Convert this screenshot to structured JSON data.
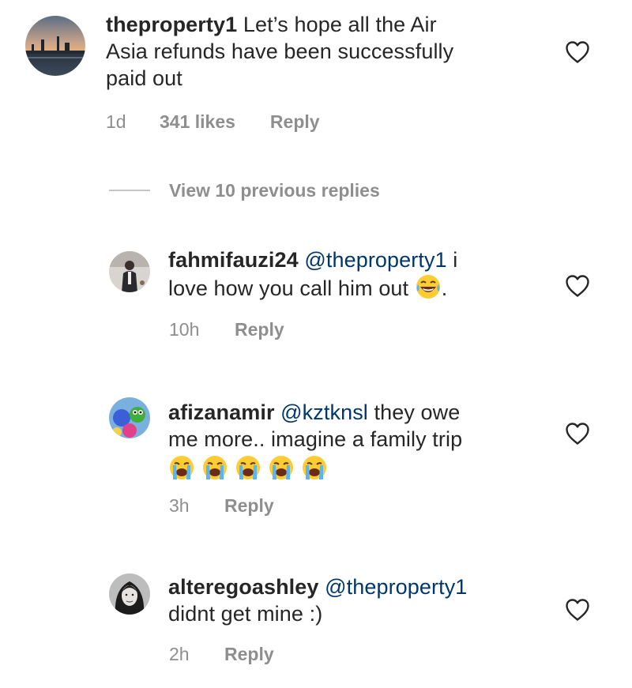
{
  "comments": [
    {
      "username": "theproperty1",
      "text_line1": " Let’s hope all the Air",
      "text_line2": "Asia refunds have been successfully",
      "text_line3": "paid out",
      "time": "1d",
      "likes": "341 likes",
      "reply": "Reply"
    },
    {
      "username": "fahmifauzi24",
      "mention": "@theproperty1",
      "text_line1_tail": " i",
      "text_line2": "love how you call him out ",
      "text_line2_tail": ".",
      "time": "10h",
      "reply": "Reply"
    },
    {
      "username": "afizanamir",
      "mention": "@kztknsl",
      "text_line1_tail": " they owe",
      "text_line2": "me more.. imagine a family trip",
      "time": "3h",
      "reply": "Reply"
    },
    {
      "username": "alteregoashley",
      "mention": "@theproperty1",
      "text_line2": "didnt get mine :)",
      "time": "2h",
      "reply": "Reply"
    }
  ],
  "view_replies": "View 10 previous replies",
  "icons": {
    "like": "heart-outline-icon",
    "laugh": "face-with-tears-of-joy-emoji",
    "cry": "loudly-crying-face-emoji"
  },
  "colors": {
    "text": "#262626",
    "secondary": "#8e8e8e",
    "mention": "#00376b"
  }
}
